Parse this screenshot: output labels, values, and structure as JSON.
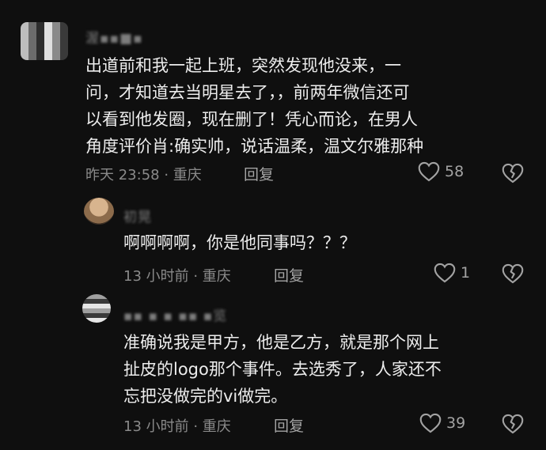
{
  "comments": [
    {
      "username": "渥▪▪■▪",
      "text": "出道前和我一起上班，突然发现他没来，一\n问，才知道去当明星去了，，前两年微信还可\n以看到他发圈，现在删了！凭心而论，在男人\n角度评价肖:确实帅，说话温柔，温文尔雅那种",
      "meta": "昨天 23:58 · 重庆",
      "reply_label": "回复",
      "likes": "58"
    },
    {
      "username": "初晃",
      "text": "啊啊啊啊，你是他同事吗？？？",
      "meta": "13 小时前 · 重庆",
      "reply_label": "回复",
      "likes": "1"
    },
    {
      "username": "▪▪ ▪ ▪ ▪▪ ▪览",
      "text": "准确说我是甲方，他是乙方，就是那个网上\n扯皮的logo那个事件。去选秀了，人家还不\n忘把没做完的vi做完。",
      "meta": "13 小时前 · 重庆",
      "reply_label": "回复",
      "likes": "39"
    }
  ],
  "icons": {
    "like": "heart-outline-icon",
    "dislike": "broken-heart-icon"
  },
  "colors": {
    "background": "#0f0f0f",
    "text": "#ededed",
    "meta": "#8a8a8a"
  }
}
